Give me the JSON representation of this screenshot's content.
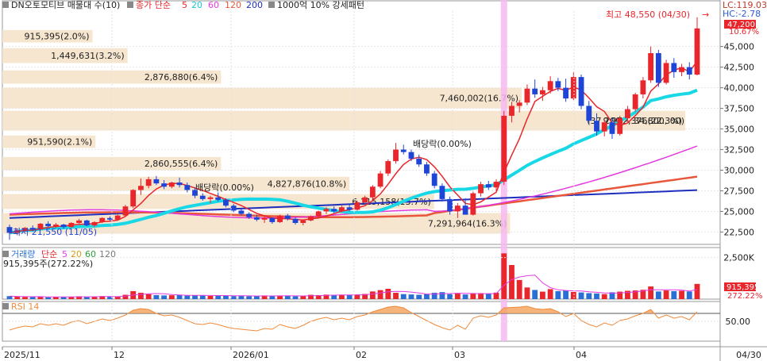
{
  "colors": {
    "up": "#e8262b",
    "down": "#1f45d6",
    "ma5": "#e8262b",
    "ma20": "#19d8e6",
    "ma60": "#e33ae0",
    "ma120": "#e8563b",
    "ma200": "#1e2fbf",
    "volBlue": "#2a6fd6",
    "band": "#f6e6cf",
    "rsi": "#f08a3a",
    "highlight": "#f6b8f0"
  },
  "legend": {
    "title": "DN오토모티브 매물대 수(10)",
    "ma_label": "종가 단순",
    "ma_periods": [
      "5",
      "20",
      "60",
      "120",
      "200"
    ],
    "pattern": "1000억 10% 강세패턴"
  },
  "right_badges": {
    "lc": "LC:119.03",
    "hc": "HC:-2.78",
    "pct": "10.67%",
    "price": "47,200"
  },
  "volume_legend": {
    "title": "거래량",
    "ma_label": "단순",
    "ma_periods": [
      "5",
      "20",
      "60",
      "120"
    ],
    "info": "915,395주(272.22%)"
  },
  "volume_badges": {
    "value": "915,395",
    "pct": "272.22%"
  },
  "rsi_legend": {
    "title": "RSI 14"
  },
  "annotations": {
    "high": "최고 48,550 (04/30)",
    "low": "최저 21,550 (11/05)",
    "dividend1": "배당락(0.00%)",
    "dividend2": "배당락(0.00%)"
  },
  "chart_data": {
    "type": "candlestick",
    "price_axis": {
      "ticks": [
        "45,000",
        "42,500",
        "40,000",
        "37,500",
        "35,000",
        "32,500",
        "30,000",
        "27,500",
        "25,000",
        "22,500"
      ],
      "ylim": [
        21000,
        49300
      ]
    },
    "volume_axis": {
      "ticks": [
        "2,500K"
      ],
      "ylim": [
        0,
        3100000
      ]
    },
    "rsi_axis": {
      "ticks": [
        "50.00"
      ],
      "ylim": [
        0,
        100
      ],
      "overbought": 70
    },
    "x_labels": [
      "2025/11",
      "12",
      "2026/01",
      "02",
      "03",
      "04",
      "04/30"
    ],
    "volume_profile": [
      {
        "label": "915,395(2.0%)",
        "from": 45500,
        "to": 47000,
        "pct": 2.0
      },
      {
        "label": "1,449,631(3.2%)",
        "from": 43000,
        "to": 44800,
        "pct": 3.2
      },
      {
        "label": "2,876,880(6.4%)",
        "from": 40500,
        "to": 42100,
        "pct": 6.4
      },
      {
        "label": "7,460,002(16.7%)",
        "from": 37500,
        "to": 40000,
        "pct": 16.7
      },
      {
        "label": "9,972,376(22.3%)",
        "from": 34800,
        "to": 37200,
        "pct": 22.3
      },
      {
        "label": "951,590(2.1%)",
        "from": 32700,
        "to": 34200,
        "pct": 2.1
      },
      {
        "label": "2,860,555(6.4%)",
        "from": 30000,
        "to": 31600,
        "pct": 6.4
      },
      {
        "label": "4,827,876(10.8%)",
        "from": 27500,
        "to": 29200,
        "pct": 10.8
      },
      {
        "label": "6,115,158(13.7%)",
        "from": 25300,
        "to": 27100,
        "pct": 13.7
      },
      {
        "label": "7,291,964(16.3%)",
        "from": 22300,
        "to": 24800,
        "pct": 16.3
      }
    ],
    "profile_extra_label": "(37,200 ~ 34,800, 00)",
    "candles": [
      [
        23100,
        23400,
        21550,
        22400
      ],
      [
        22400,
        22900,
        22100,
        22700
      ],
      [
        22700,
        23100,
        22500,
        23000
      ],
      [
        23000,
        23300,
        22600,
        22800
      ],
      [
        22800,
        23600,
        22700,
        23500
      ],
      [
        23500,
        23800,
        23100,
        23200
      ],
      [
        23200,
        23600,
        23000,
        23400
      ],
      [
        23400,
        23500,
        22900,
        23100
      ],
      [
        23100,
        23700,
        23000,
        23600
      ],
      [
        23600,
        24100,
        23400,
        23900
      ],
      [
        23900,
        24000,
        23200,
        23300
      ],
      [
        23300,
        23800,
        23100,
        23700
      ],
      [
        23700,
        24300,
        23600,
        24200
      ],
      [
        24200,
        24400,
        23800,
        24000
      ],
      [
        24000,
        24600,
        23900,
        24500
      ],
      [
        24500,
        25800,
        24400,
        25600
      ],
      [
        25600,
        27700,
        25400,
        27600
      ],
      [
        27600,
        29000,
        27000,
        28100
      ],
      [
        28100,
        29200,
        27800,
        28900
      ],
      [
        28900,
        29300,
        28200,
        28400
      ],
      [
        28400,
        28800,
        27700,
        28000
      ],
      [
        28000,
        28600,
        27800,
        28500
      ],
      [
        28500,
        29100,
        27900,
        28200
      ],
      [
        28200,
        28500,
        27300,
        27600
      ],
      [
        27600,
        27900,
        26600,
        26900
      ],
      [
        26900,
        27200,
        26300,
        26500
      ],
      [
        26500,
        26900,
        26000,
        26700
      ],
      [
        26700,
        27300,
        26200,
        26400
      ],
      [
        26400,
        26600,
        25500,
        25700
      ],
      [
        25700,
        25900,
        24900,
        25100
      ],
      [
        25100,
        25300,
        24500,
        24700
      ],
      [
        24700,
        24900,
        24100,
        24300
      ],
      [
        24300,
        24600,
        23800,
        24000
      ],
      [
        24000,
        24400,
        23600,
        24200
      ],
      [
        24200,
        24300,
        23500,
        23700
      ],
      [
        23700,
        24600,
        23600,
        24500
      ],
      [
        24500,
        24700,
        23900,
        24100
      ],
      [
        24100,
        24300,
        23400,
        23600
      ],
      [
        23600,
        24000,
        23300,
        23900
      ],
      [
        23900,
        24500,
        23800,
        24400
      ],
      [
        24400,
        25100,
        24200,
        25000
      ],
      [
        25000,
        25500,
        24700,
        25300
      ],
      [
        25300,
        25600,
        24800,
        25000
      ],
      [
        25000,
        25700,
        24900,
        25500
      ],
      [
        25500,
        25800,
        25000,
        25200
      ],
      [
        25200,
        26300,
        25100,
        26100
      ],
      [
        26100,
        26900,
        25900,
        26700
      ],
      [
        26700,
        28200,
        26500,
        28000
      ],
      [
        28000,
        29900,
        27800,
        29600
      ],
      [
        29600,
        31300,
        29300,
        31100
      ],
      [
        31100,
        33300,
        30800,
        32500
      ],
      [
        32500,
        33100,
        31900,
        32200
      ],
      [
        32200,
        32500,
        31100,
        31400
      ],
      [
        31400,
        31900,
        30400,
        30700
      ],
      [
        30700,
        31000,
        29300,
        29600
      ],
      [
        29600,
        29900,
        27800,
        28100
      ],
      [
        28100,
        28400,
        26200,
        26500
      ],
      [
        26500,
        26800,
        24600,
        25000
      ],
      [
        25000,
        26000,
        24200,
        25700
      ],
      [
        25700,
        26600,
        25200,
        24600
      ],
      [
        24600,
        27400,
        24500,
        27200
      ],
      [
        27200,
        28600,
        26800,
        28300
      ],
      [
        28300,
        28700,
        27600,
        27900
      ],
      [
        27900,
        28900,
        27500,
        28600
      ],
      [
        28600,
        37200,
        28200,
        36600
      ],
      [
        36600,
        38300,
        35800,
        37800
      ],
      [
        37800,
        38500,
        37000,
        38200
      ],
      [
        38200,
        40400,
        37900,
        39900
      ],
      [
        39900,
        41000,
        38800,
        39200
      ],
      [
        39200,
        40100,
        38400,
        39700
      ],
      [
        39700,
        41400,
        39300,
        40800
      ],
      [
        40800,
        41200,
        39600,
        40000
      ],
      [
        40000,
        41100,
        38300,
        38700
      ],
      [
        38700,
        41900,
        38500,
        41300
      ],
      [
        41300,
        41600,
        37400,
        37800
      ],
      [
        37800,
        38400,
        35600,
        36000
      ],
      [
        36000,
        36900,
        34200,
        34700
      ],
      [
        34700,
        36100,
        34100,
        35800
      ],
      [
        35800,
        36300,
        33800,
        34400
      ],
      [
        34400,
        36600,
        34200,
        36300
      ],
      [
        36300,
        37800,
        35900,
        37400
      ],
      [
        37400,
        39400,
        37100,
        39200
      ],
      [
        39200,
        41300,
        38700,
        40900
      ],
      [
        40900,
        45000,
        40600,
        44200
      ],
      [
        44200,
        44600,
        40100,
        40600
      ],
      [
        40600,
        43400,
        40400,
        43000
      ],
      [
        43000,
        43600,
        41200,
        41900
      ],
      [
        41900,
        42900,
        41400,
        42500
      ],
      [
        42500,
        43100,
        41000,
        41600
      ],
      [
        41600,
        48550,
        41500,
        47200
      ]
    ],
    "volume": [
      180,
      140,
      130,
      120,
      160,
      110,
      120,
      130,
      150,
      170,
      120,
      140,
      180,
      150,
      160,
      260,
      480,
      380,
      300,
      240,
      220,
      230,
      250,
      210,
      230,
      210,
      190,
      240,
      200,
      180,
      190,
      170,
      200,
      220,
      180,
      210,
      190,
      170,
      200,
      260,
      240,
      270,
      230,
      250,
      240,
      280,
      310,
      460,
      540,
      620,
      380,
      300,
      280,
      260,
      300,
      380,
      420,
      300,
      360,
      280,
      330,
      360,
      320,
      390,
      2750,
      2050,
      1150,
      700,
      550,
      450,
      600,
      480,
      520,
      430,
      400,
      360,
      340,
      300,
      410,
      450,
      500,
      520,
      560,
      760,
      460,
      520,
      480,
      500,
      460,
      915
    ],
    "rsi": [
      28,
      34,
      38,
      36,
      44,
      40,
      44,
      40,
      48,
      52,
      44,
      50,
      56,
      52,
      58,
      66,
      78,
      82,
      80,
      70,
      64,
      66,
      60,
      52,
      44,
      42,
      46,
      42,
      36,
      32,
      30,
      28,
      26,
      32,
      30,
      42,
      36,
      32,
      40,
      50,
      56,
      60,
      54,
      58,
      54,
      62,
      66,
      74,
      80,
      86,
      88,
      84,
      72,
      62,
      52,
      42,
      34,
      28,
      40,
      30,
      58,
      64,
      60,
      66,
      84,
      85,
      86,
      88,
      82,
      80,
      82,
      74,
      62,
      70,
      52,
      42,
      36,
      46,
      40,
      52,
      56,
      64,
      70,
      80,
      58,
      66,
      58,
      62,
      54,
      74
    ]
  }
}
